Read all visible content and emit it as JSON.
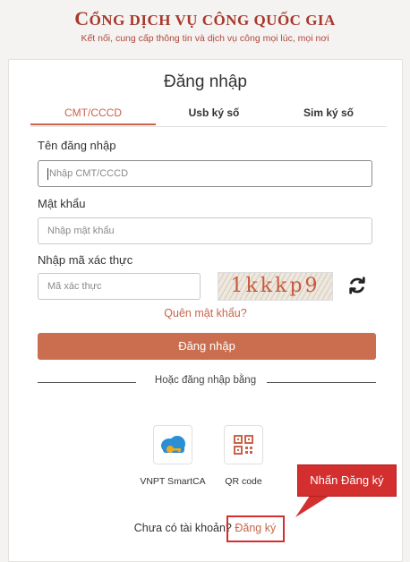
{
  "header": {
    "title_first": "C",
    "title_rest": "ỔNG DỊCH VỤ CÔNG QUỐC GIA",
    "subtitle": "Kết nối, cung cấp thông tin và dịch vụ công mọi lúc, mọi nơi"
  },
  "login": {
    "title": "Đăng nhập",
    "tabs": [
      {
        "label": "CMT/CCCD",
        "active": true
      },
      {
        "label": "Usb ký số",
        "active": false
      },
      {
        "label": "Sim ký số",
        "active": false
      }
    ],
    "username_label": "Tên đăng nhập",
    "username_placeholder": "Nhập CMT/CCCD",
    "password_label": "Mật khẩu",
    "password_placeholder": "Nhập mật khẩu",
    "captcha_label": "Nhập mã xác thực",
    "captcha_placeholder": "Mã xác thực",
    "captcha_text": "1kkkp9",
    "forgot_password": "Quên mật khẩu?",
    "submit_label": "Đăng nhập",
    "alt_divider": "Hoặc đăng nhập bằng",
    "methods": [
      {
        "label": "VNPT SmartCA",
        "icon": "cloud-key-icon"
      },
      {
        "label": "QR code",
        "icon": "qr-code-icon"
      }
    ],
    "no_account": "Chưa có tài khoản?",
    "signup_link": "Đăng ký"
  },
  "annotation": {
    "callout_text": "Nhấn Đăng ký"
  },
  "colors": {
    "brand": "#a8382b",
    "accent": "#c8644a",
    "button": "#cb6e4f",
    "annotation": "#d42f2f"
  }
}
